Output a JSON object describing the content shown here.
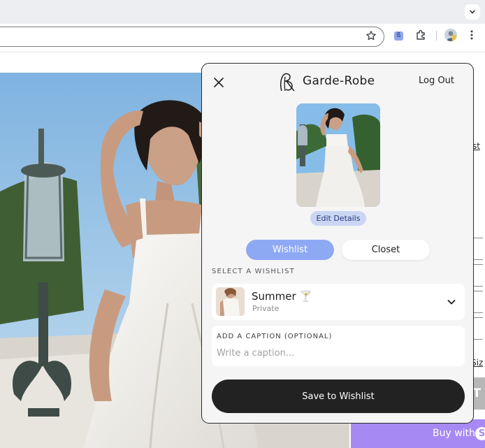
{
  "browser": {
    "tab_menu_icon": "chevron-down-icon",
    "toolbar_icons": [
      "star-icon",
      "extension-garde-robe-icon",
      "puzzle-icon",
      "profile-avatar",
      "more-vert-icon"
    ],
    "extension_badge": "ß"
  },
  "page": {
    "link_partial": "st",
    "size_link_partial": "Siz",
    "add_to_cart_partial": "CT",
    "buy_with_label": "Buy with",
    "buy_with_logo": "S",
    "buy_color": "#a789f3"
  },
  "panel": {
    "brand_name": "Garde-Robe",
    "logout_label": "Log Out",
    "edit_details_label": "Edit Details",
    "tabs": [
      {
        "label": "Wishlist",
        "active": true
      },
      {
        "label": "Closet",
        "active": false
      }
    ],
    "select_label": "SELECT A WISHLIST",
    "selected_wishlist": {
      "name": "Summer 🍸",
      "visibility": "Private"
    },
    "caption": {
      "label": "ADD A CAPTION (OPTIONAL)",
      "placeholder": "Write a caption...",
      "value": ""
    },
    "save_label": "Save to Wishlist",
    "accent_color": "#8ea9f4"
  }
}
